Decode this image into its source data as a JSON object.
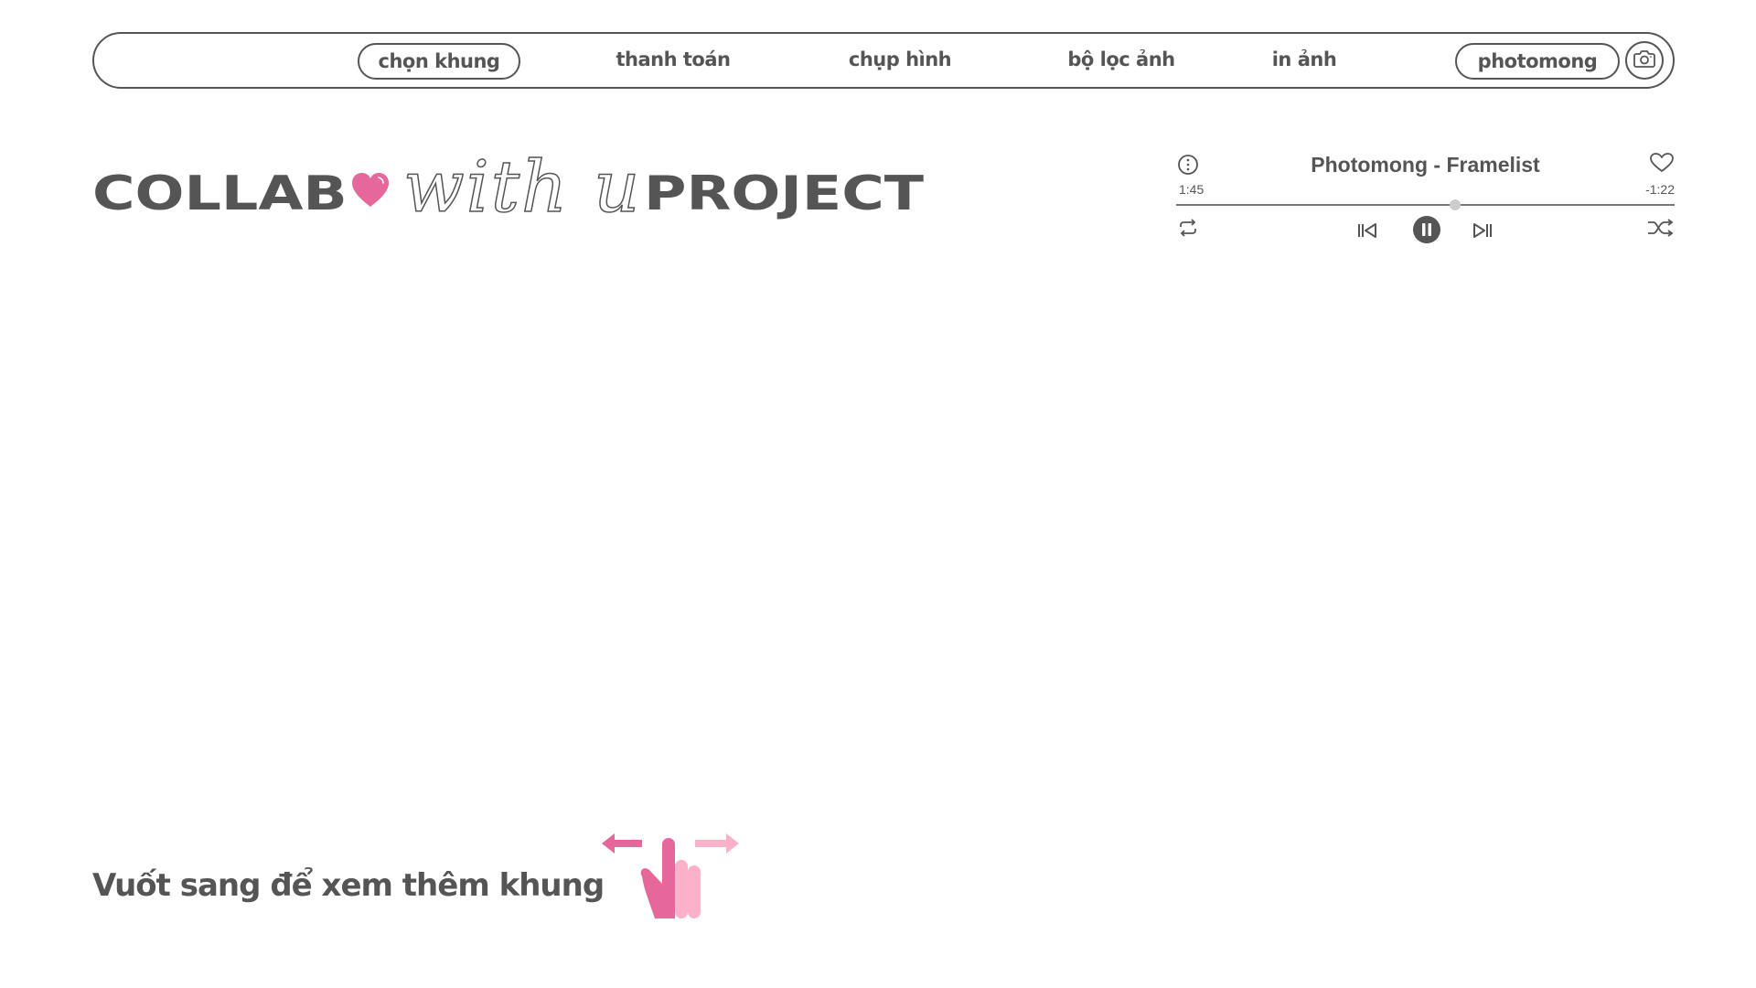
{
  "nav": {
    "items": [
      {
        "label": "chọn khung",
        "active": true
      },
      {
        "label": "thanh toán"
      },
      {
        "label": "chụp hình"
      },
      {
        "label": "bộ lọc ảnh"
      },
      {
        "label": "in ảnh"
      },
      {
        "label": "photomong",
        "pill": true
      }
    ],
    "camera_icon": "camera-icon"
  },
  "title": {
    "part1": "COLLAB",
    "heart_icon": "heart-icon",
    "script": "with u",
    "part2": "PROJECT"
  },
  "player": {
    "song": "Photomong - Framelist",
    "elapsed": "1:45",
    "remaining": "-1:22",
    "progress": 0.56,
    "icons": [
      "info-icon",
      "like-icon",
      "repeat-icon",
      "previous-icon",
      "pause-icon",
      "next-icon",
      "shuffle-icon"
    ]
  },
  "swipe": {
    "text": "Vuốt sang để xem thêm khung",
    "icon": "swipe-hand-icon"
  },
  "colors": {
    "text": "#555555",
    "accent_pink": "#e5679c",
    "light_pink": "#fbb1c9",
    "background": "#ffffff"
  }
}
